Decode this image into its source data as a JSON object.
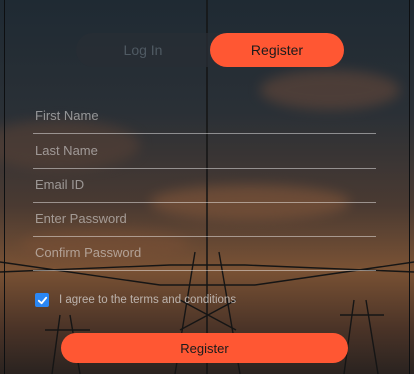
{
  "theme": {
    "accent": "#ff5733",
    "checkbox": "#2a87f5"
  },
  "auth_toggle": {
    "login_label": "Log In",
    "register_label": "Register",
    "active": "register"
  },
  "form": {
    "fields": [
      {
        "placeholder": "First Name",
        "value": ""
      },
      {
        "placeholder": "Last Name",
        "value": ""
      },
      {
        "placeholder": "Email ID",
        "value": ""
      },
      {
        "placeholder": "Enter Password",
        "value": ""
      },
      {
        "placeholder": "Confirm Password",
        "value": ""
      }
    ],
    "terms_label": "I agree to the terms and conditions",
    "terms_checked": true,
    "submit_label": "Register"
  }
}
